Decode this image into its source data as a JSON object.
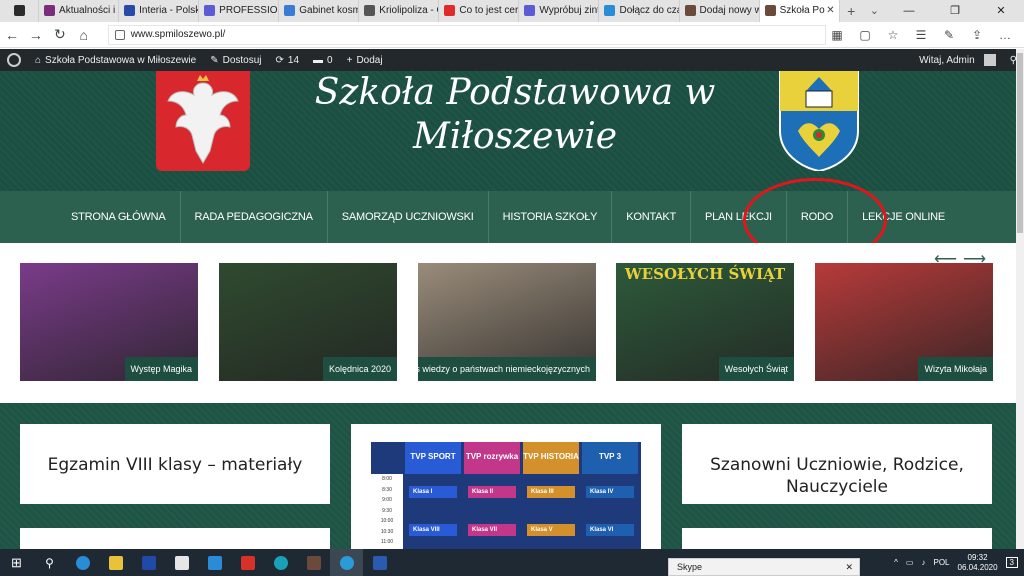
{
  "browser": {
    "tabs": [
      {
        "label": "",
        "color": "#2b2b2b"
      },
      {
        "label": "Aktualności i I",
        "color": "#7b2d7b"
      },
      {
        "label": "Interia - Polsk",
        "color": "#2a4aa8"
      },
      {
        "label": "PROFESSIONA",
        "color": "#5b5bd6"
      },
      {
        "label": "Gabinet kosm",
        "color": "#3a7bd5"
      },
      {
        "label": "Kriolipoliza - C",
        "color": "#555555"
      },
      {
        "label": "Co to jest cert",
        "color": "#e02a2a"
      },
      {
        "label": "Wypróbuj zint",
        "color": "#5b5bd6"
      },
      {
        "label": "Dołącz do cza",
        "color": "#2a8bd6"
      },
      {
        "label": "Dodaj nowy w",
        "color": "#6a4a3a"
      },
      {
        "label": "Szkoła Po",
        "color": "#6a4a3a"
      }
    ],
    "url": "www.spmiloszewo.pl/"
  },
  "wpbar": {
    "site": "Szkoła Podstawowa w Miłoszewie",
    "customize": "Dostosuj",
    "updates": "14",
    "comments": "0",
    "add": "Dodaj",
    "greeting": "Witaj, Admin"
  },
  "header": {
    "title": "Szkoła Podstawowa w Miłoszewie"
  },
  "nav": {
    "items": [
      "STRONA GŁÓWNA",
      "RADA PEDAGOGICZNA",
      "SAMORZĄD UCZNIOWSKI",
      "HISTORIA SZKOŁY",
      "KONTAKT",
      "PLAN LEKCJI",
      "RODO",
      "LEKCJE ONLINE"
    ]
  },
  "slider": {
    "slides": [
      {
        "caption": "Występ Magika",
        "color": "#7a3b8a"
      },
      {
        "caption": "Kolędnica 2020",
        "color": "#2f4a2f"
      },
      {
        "caption": "Konkurs wiedzy o państwach niemieckojęzycznych",
        "color": "#9a8c7a"
      },
      {
        "caption": "Wesołych Świąt",
        "color": "#2d5a3a",
        "banner": "WESOŁYCH ŚWIĄT"
      },
      {
        "caption": "Wizyta Mikołaja",
        "color": "#b83a3a"
      }
    ]
  },
  "cards": {
    "left_title": "Egzamin VIII klasy – materiały",
    "right_title": "Szanowni Uczniowie, Rodzice, Nauczyciele"
  },
  "tv": {
    "columns": [
      {
        "head": "TVP SPORT",
        "color": "#2a5bd6",
        "classes": [
          "Klasa I",
          "Klasa VIII"
        ]
      },
      {
        "head": "TVP rozrywka",
        "color": "#c2378a",
        "classes": [
          "Klasa II",
          "Klasa VII"
        ]
      },
      {
        "head": "TVP HISTORIA",
        "color": "#d4902a",
        "classes": [
          "Klasa III",
          "Klasa V"
        ]
      },
      {
        "head": "TVP 3",
        "color": "#1f5fb0",
        "classes": [
          "Klasa IV",
          "Klasa VI"
        ]
      }
    ],
    "times": [
      "8:00",
      "8:30",
      "9:00",
      "9:30",
      "10:00",
      "10:30",
      "11:00",
      "11:30"
    ]
  },
  "taskbar": {
    "skype": "Skype",
    "lang": "POL",
    "time": "09:32",
    "date": "06.04.2020",
    "notifications": "3"
  }
}
